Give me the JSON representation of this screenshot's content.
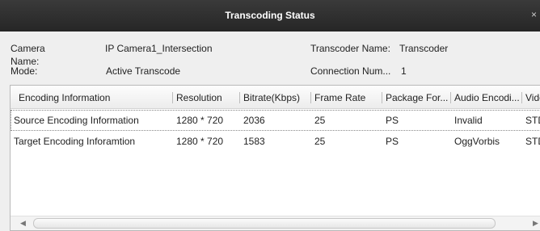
{
  "window": {
    "title": "Transcoding Status",
    "close_glyph": "×"
  },
  "info": {
    "camera_name_label": "Camera Name:",
    "camera_name_value": "IP Camera1_Intersection",
    "transcoder_name_label": "Transcoder Name:",
    "transcoder_name_value": "Transcoder",
    "mode_label": "Mode:",
    "mode_value": "Active Transcode",
    "connection_num_label": "Connection Num...",
    "connection_num_value": "1"
  },
  "table": {
    "columns": [
      "Encoding Information",
      "Resolution",
      "Bitrate(Kbps)",
      "Frame Rate",
      "Package For...",
      "Audio Encodi...",
      "Vide"
    ],
    "rows": [
      [
        "Source Encoding Information",
        "1280 * 720",
        "2036",
        "25",
        "PS",
        "Invalid",
        "STD"
      ],
      [
        "Target Encoding Inforamtion",
        "1280 * 720",
        "1583",
        "25",
        "PS",
        "OggVorbis",
        "STD"
      ]
    ]
  },
  "scrollbar": {
    "left_arrow_icon": "left-arrow-icon",
    "right_arrow_icon": "right-arrow-icon"
  }
}
